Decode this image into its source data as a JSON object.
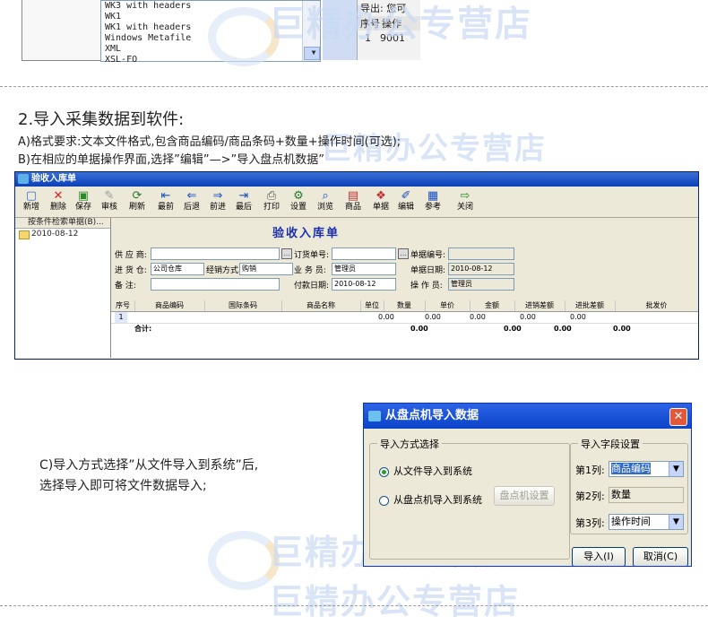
{
  "top_fragment": {
    "list_items": [
      "WK3 with headers",
      "WK1",
      "WK1 with headers",
      "Windows Metafile",
      "XML",
      "XSL-FO"
    ],
    "right_text": "导出: 您可",
    "table_headers": [
      "序号",
      "操作"
    ],
    "table_row": [
      "1",
      "9001"
    ]
  },
  "section": {
    "title": "2.导入采集数据到软件:",
    "line_a": "A)格式要求:文本文件格式,包含商品编码/商品条码+数量+操作时间(可选);",
    "line_b": "B)在相应的单据操作界面,选择”编辑”—>”导入盘点机数据”",
    "caption_c1": "C)导入方式选择”从文件导入到系统”后,",
    "caption_c2": "选择导入即可将文件数据导入;"
  },
  "watermark": "巨精办公专营店",
  "app": {
    "title": "验收入库单",
    "toolbar": [
      {
        "label": "新增",
        "icon": "new-doc-icon",
        "glyph": "▢",
        "color": "#3b6bd6"
      },
      {
        "label": "删除",
        "icon": "delete-icon",
        "glyph": "✕",
        "color": "#d42020"
      },
      {
        "label": "保存",
        "icon": "save-icon",
        "glyph": "▣",
        "color": "#2a8a2a"
      },
      {
        "label": "审核",
        "icon": "approve-icon",
        "glyph": "✎",
        "color": "#999999"
      },
      {
        "label": "刷新",
        "icon": "refresh-icon",
        "glyph": "⟳",
        "color": "#2a7a2a"
      },
      {
        "label": "最前",
        "icon": "first-icon",
        "glyph": "⇤",
        "color": "#1a4fbf"
      },
      {
        "label": "后退",
        "icon": "back-icon",
        "glyph": "⇐",
        "color": "#1a4fbf"
      },
      {
        "label": "前进",
        "icon": "forward-icon",
        "glyph": "⇒",
        "color": "#1a4fbf"
      },
      {
        "label": "最后",
        "icon": "last-icon",
        "glyph": "⇥",
        "color": "#1a4fbf"
      },
      {
        "label": "打印",
        "icon": "print-icon",
        "glyph": "⎙",
        "color": "#555555"
      },
      {
        "label": "设置",
        "icon": "settings-icon",
        "glyph": "⚙",
        "color": "#2a7a2a"
      },
      {
        "label": "浏览",
        "icon": "browse-icon",
        "glyph": "⌕",
        "color": "#1a4fbf"
      },
      {
        "label": "商品",
        "icon": "goods-icon",
        "glyph": "▤",
        "color": "#c03030"
      },
      {
        "label": "单据",
        "icon": "bill-icon",
        "glyph": "❖",
        "color": "#c03030"
      },
      {
        "label": "编辑",
        "icon": "edit-icon",
        "glyph": "✐",
        "color": "#1a4fbf"
      },
      {
        "label": "参考",
        "icon": "reference-icon",
        "glyph": "▦",
        "color": "#1a4fbf"
      },
      {
        "label": "关闭",
        "icon": "close-door-icon",
        "glyph": "⇨",
        "color": "#2a8a2a"
      }
    ],
    "tree_header": "按条件检索单据(B)...",
    "tree_node": "2010-08-12",
    "form_title": "验收入库单",
    "fields": {
      "supplier_label": "供 应 商:",
      "supplier_value": "",
      "warehouse_label": "进 货 仓:",
      "warehouse_value": "公司仓库",
      "sale_mode_label": "经销方式:",
      "sale_mode_value": "购销",
      "note_label": "备    注:",
      "note_value": "",
      "order_no_label": "订货单号:",
      "order_no_value": "",
      "staff_label": "业 务 员:",
      "staff_value": "管理员",
      "pay_date_label": "付款日期:",
      "pay_date_value": "2010-08-12",
      "bill_no_label": "单据编号:",
      "bill_no_value": "",
      "bill_date_label": "单据日期:",
      "bill_date_value": "2010-08-12",
      "operator_label": "操 作 员:",
      "operator_value": "管理员"
    },
    "grid_headers": [
      "序号",
      "商品编码",
      "国际条码",
      "商品名称",
      "单位",
      "数量",
      "单价",
      "金额",
      "进销差额",
      "进批差额",
      "批发价"
    ],
    "grid_row": {
      "no": "1",
      "qty": "0.00",
      "price": "0.00",
      "amount": "0.00",
      "diff1": "0.00",
      "diff2": "0.00"
    },
    "grid_total": {
      "label": "合计:",
      "qty": "0.00",
      "amount": "0.00",
      "diff1": "0.00",
      "diff2": "0.00"
    }
  },
  "dialog": {
    "title": "从盘点机导入数据",
    "group_mode": "导入方式选择",
    "radio_file": "从文件导入到系统",
    "radio_device": "从盘点机导入到系统",
    "device_settings": "盘点机设置",
    "group_fields": "导入字段设置",
    "col1_label": "第1列:",
    "col1_value": "商品编码",
    "col2_label": "第2列:",
    "col2_value": "数量",
    "col3_label": "第3列:",
    "col3_value": "操作时间",
    "import_button": "导入(I)",
    "cancel_button": "取消(C)"
  }
}
